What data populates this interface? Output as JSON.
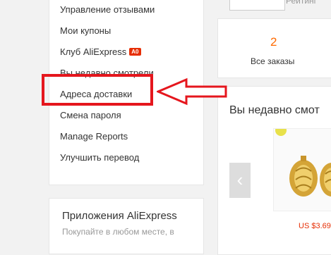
{
  "sidebar": {
    "items": [
      {
        "label": "Управление отзывами"
      },
      {
        "label": "Мои купоны"
      },
      {
        "label": "Клуб AliExpress",
        "badge": "A0"
      },
      {
        "label": "Вы недавно смотрели"
      },
      {
        "label": "Адреса доставки"
      },
      {
        "label": "Смена пароля"
      },
      {
        "label": "Manage Reports"
      },
      {
        "label": "Улучшить перевод"
      }
    ]
  },
  "apps_promo": {
    "title": "Приложения AliExpress",
    "subtitle": "Покупайте в любом месте, в"
  },
  "header": {
    "rating_label": "Рейтинг"
  },
  "orders": {
    "count": "2",
    "label": "Все заказы"
  },
  "recently_viewed": {
    "title": "Вы недавно смот",
    "items": [
      {
        "price": "US $3.69"
      }
    ]
  },
  "colors": {
    "accent": "#ff6a00",
    "price": "#e62e04",
    "annotation": "#e5161d",
    "badge": "#e62e04"
  }
}
